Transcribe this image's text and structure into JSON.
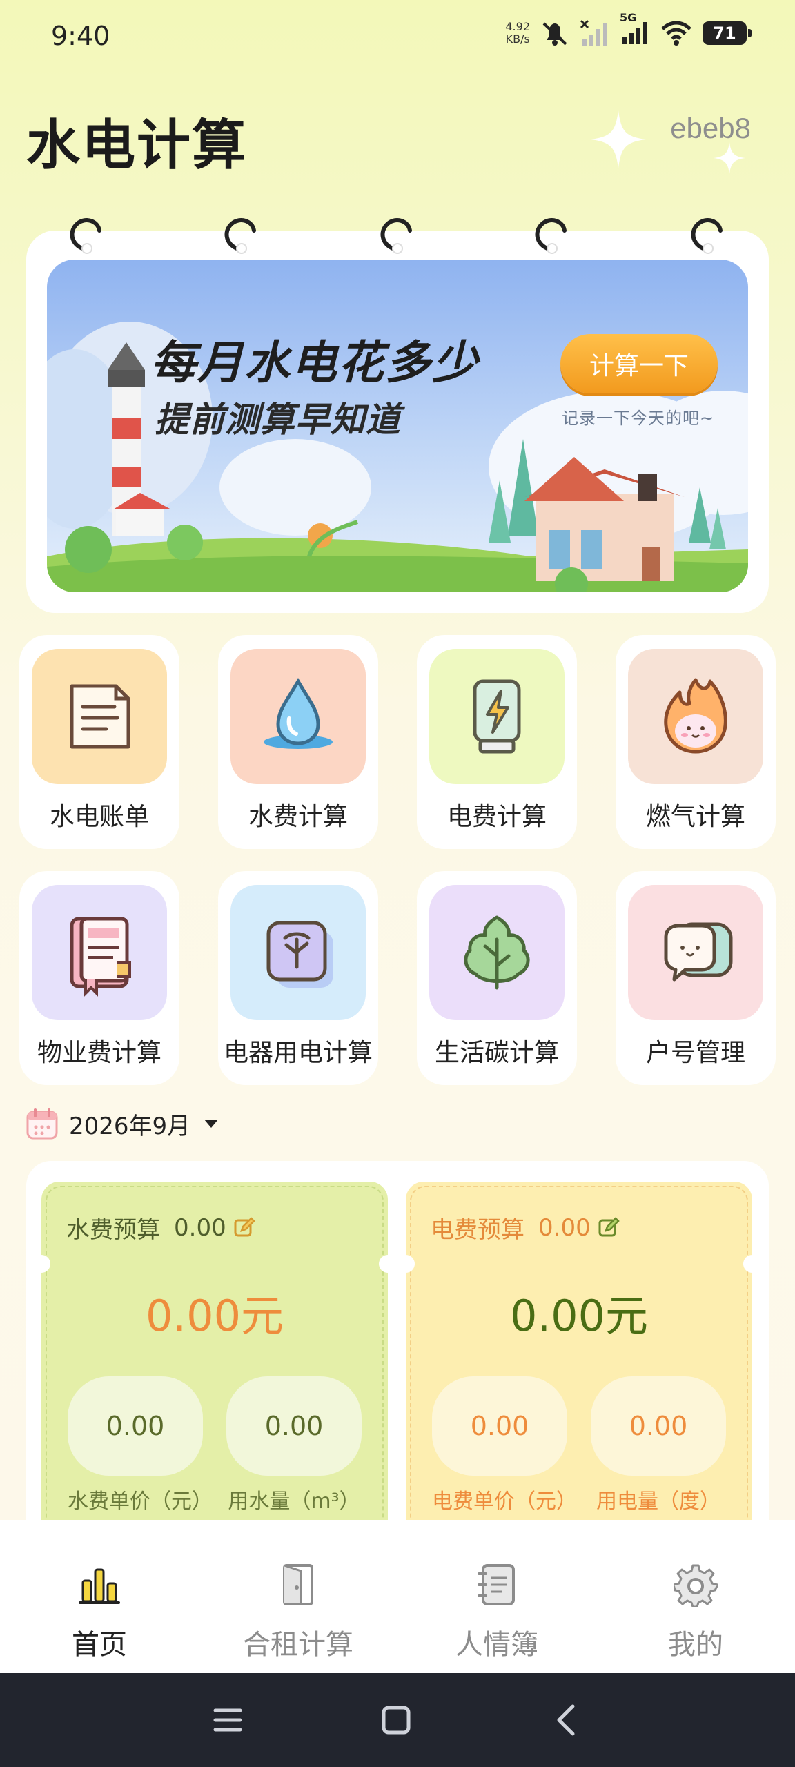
{
  "status_bar": {
    "time": "9:40",
    "net_speed_value": "4.92",
    "net_speed_unit": "KB/s",
    "network": "5G",
    "battery": "71"
  },
  "header": {
    "title": "水电计算",
    "user_id": "ebeb8"
  },
  "banner": {
    "headline": "每月水电花多少",
    "subheadline": "提前测算早知道",
    "button_label": "计算一下",
    "note": "记录一下今天的吧~"
  },
  "features": [
    {
      "label": "水电账单",
      "icon": "bill-icon",
      "bg": "#fde2b0"
    },
    {
      "label": "水费计算",
      "icon": "water-drop-icon",
      "bg": "#fcd6c4"
    },
    {
      "label": "电费计算",
      "icon": "battery-bolt-icon",
      "bg": "#eef9c0"
    },
    {
      "label": "燃气计算",
      "icon": "flame-icon",
      "bg": "#f7e2d6"
    },
    {
      "label": "物业费计算",
      "icon": "notebook-icon",
      "bg": "#e6e1fb"
    },
    {
      "label": "电器用电计算",
      "icon": "appliance-icon",
      "bg": "#d5ecfb"
    },
    {
      "label": "生活碳计算",
      "icon": "leaf-icon",
      "bg": "#ebdefa"
    },
    {
      "label": "户号管理",
      "icon": "chat-icon",
      "bg": "#fbdfe1"
    }
  ],
  "month_selector": {
    "label": "2026年9月"
  },
  "water_budget": {
    "title": "水费预算",
    "budget_value": "0.00",
    "amount": "0.00元",
    "unit_price": "0.00",
    "unit_price_label": "水费单价（元）",
    "usage": "0.00",
    "usage_label": "用水量（m³）"
  },
  "electric_budget": {
    "title": "电费预算",
    "budget_value": "0.00",
    "amount": "0.00元",
    "unit_price": "0.00",
    "unit_price_label": "电费单价（元）",
    "usage": "0.00",
    "usage_label": "用电量（度）"
  },
  "tabs": [
    {
      "label": "首页",
      "icon": "bar-chart-icon",
      "active": true
    },
    {
      "label": "合租计算",
      "icon": "door-icon",
      "active": false
    },
    {
      "label": "人情簿",
      "icon": "contact-book-icon",
      "active": false
    },
    {
      "label": "我的",
      "icon": "gear-icon",
      "active": false
    }
  ],
  "colors": {
    "accent_orange": "#ee8c3c",
    "water_green": "#e4efa8",
    "electric_yellow": "#fdeeb0",
    "amount_green": "#4a6d14",
    "tab_active": "#222222",
    "tab_inactive": "#8c8c8c"
  }
}
